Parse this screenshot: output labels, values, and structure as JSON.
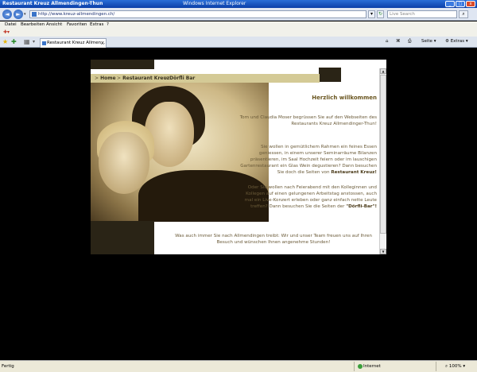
{
  "window": {
    "title": "Restaurant Kreuz Allmendingen-Thun",
    "app_name": "Windows Internet Explorer",
    "minimize": "_",
    "maximize": "□",
    "close": "x"
  },
  "address_bar": {
    "back": "◄",
    "forward": "►",
    "url": "http://www.kreuz-allmendingen.ch/",
    "refresh": "↻",
    "stop": "x",
    "search_placeholder": "Live Search",
    "search_button": "⌕"
  },
  "menu": [
    "Datei",
    "Bearbeiten",
    "Ansicht",
    "Favoriten",
    "Extras",
    "?"
  ],
  "tab": {
    "label": "Restaurant Kreuz Allmen...",
    "close": "x"
  },
  "command_bar": {
    "home": "⌂",
    "feeds": "⌘",
    "print": "⎙",
    "page": "Seite",
    "tools": "Extras"
  },
  "site": {
    "nav": [
      "Home",
      "Restaurant Kreuz",
      "Dörfli Bar"
    ],
    "nav_sep": ">",
    "heading": "Herzlich willkommen",
    "p1": "Tom und Claudia Moser begrüssen Sie auf den Webseiten des Restaurants Kreuz Allmendinger-Thun!",
    "p2_text": "Sie wollen in gemütlichem Rahmen ein feines Essen geniessen, in einem unserer Seminarräume Bilanzen präsentieren, im Saal Hochzeit feiern oder im lauschigen Gartenrestaurant ein Glas Wein degustieren? Dann besuchen Sie doch die Seiten von",
    "p2_bold": "Restaurant Kreuz!",
    "p3_text": "Oder Sie wollen nach Feierabend mit den Kolleginnen und Kollegen auf einen gelungenen Arbeitstag anstossen, auch mal ein Live-Konzert erleben oder ganz einfach nette Leute treffen? Dann besuchen Sie die Seiten der",
    "p3_bold": "\"Dörfli-Bar\"!",
    "p4": "Was auch immer Sie nach Allmendingen treibt: Wir und unser Team freuen uns auf Ihren Besuch und wünschen Ihnen angenehme Stunden!"
  },
  "status_bar": {
    "status": "Fertig",
    "zone": "Internet",
    "zoom": "100%"
  }
}
